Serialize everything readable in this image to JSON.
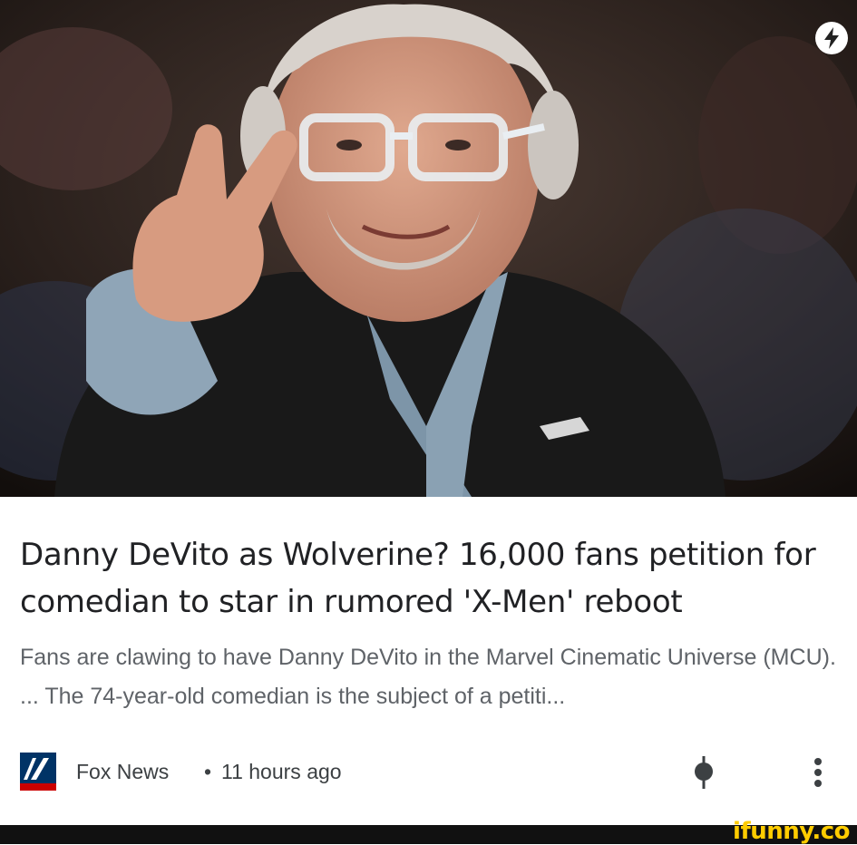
{
  "article": {
    "headline": "Danny DeVito as Wolverine? 16,000 fans petition for comedian to star in rumored 'X-Men' reboot",
    "snippet": "Fans are clawing to have Danny DeVito in the Marvel Cinematic Universe (MCU). ... The 74-year-old comedian is the subject of a petiti...",
    "source": "Fox News",
    "separator": "•",
    "time_ago": "11 hours ago"
  },
  "icons": {
    "amp": "lightning-bolt-icon",
    "source_logo": "fox-news-logo",
    "pin": "pin-icon",
    "more": "more-vertical-icon"
  },
  "watermark": {
    "text": "ifunny.co"
  },
  "colors": {
    "headline": "#202124",
    "snippet": "#5f6368",
    "fox_blue": "#003366",
    "fox_red": "#cc0000",
    "ifunny_yellow": "#ffcc00"
  }
}
